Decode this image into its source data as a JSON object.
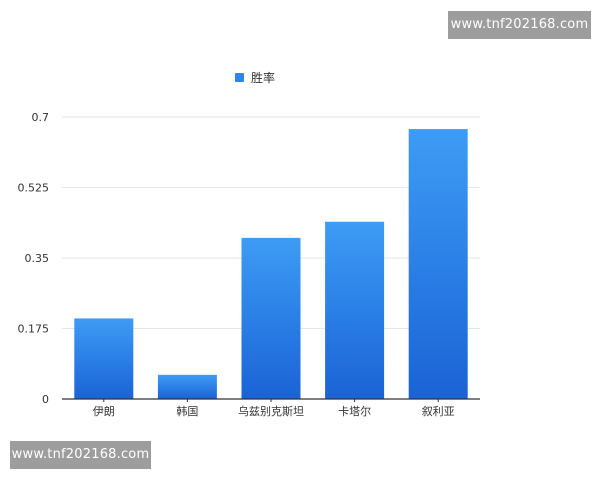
{
  "watermarks": {
    "top": "www.tnf202168.com",
    "bottom": "www.tnf202168.com"
  },
  "chart_data": {
    "type": "bar",
    "categories": [
      "伊朗",
      "韩国",
      "乌兹别克斯坦",
      "卡塔尔",
      "叙利亚"
    ],
    "series": [
      {
        "name": "胜率",
        "values": [
          0.2,
          0.06,
          0.4,
          0.44,
          0.67
        ]
      }
    ],
    "y_ticks": [
      "0",
      "0.175",
      "0.35",
      "0.525",
      "0.7"
    ],
    "ylim": [
      0,
      0.7
    ],
    "grid": true,
    "legend_position": "top-center",
    "colors": {
      "bar_top": "#3d9cf5",
      "bar_bottom": "#1a63d6",
      "legend_swatch": "#2f86e8",
      "grid": "#e6e6e6",
      "axis": "#333333"
    }
  }
}
